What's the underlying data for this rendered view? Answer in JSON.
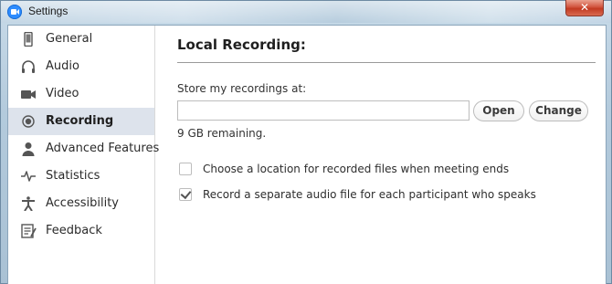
{
  "window": {
    "title": "Settings",
    "close_glyph": "✕"
  },
  "sidebar": {
    "items": [
      {
        "label": "General",
        "icon": "tablet-icon",
        "active": false
      },
      {
        "label": "Audio",
        "icon": "headphones-icon",
        "active": false
      },
      {
        "label": "Video",
        "icon": "video-camera-icon",
        "active": false
      },
      {
        "label": "Recording",
        "icon": "record-icon",
        "active": true
      },
      {
        "label": "Advanced Features",
        "icon": "user-icon",
        "active": false
      },
      {
        "label": "Statistics",
        "icon": "pulse-icon",
        "active": false
      },
      {
        "label": "Accessibility",
        "icon": "accessibility-icon",
        "active": false
      },
      {
        "label": "Feedback",
        "icon": "feedback-icon",
        "active": false
      }
    ]
  },
  "main": {
    "section_title": "Local Recording:",
    "store_label": "Store my recordings at:",
    "path_value": "",
    "open_label": "Open",
    "change_label": "Change",
    "remaining": "9 GB remaining.",
    "options": [
      {
        "label": "Choose a location for recorded files when meeting ends",
        "checked": false
      },
      {
        "label": "Record a separate audio file for each participant who speaks",
        "checked": true
      }
    ]
  },
  "colors": {
    "active_item_bg": "#dde3ec",
    "app_icon": "#2d8cff",
    "close_button": "#c23a22"
  }
}
